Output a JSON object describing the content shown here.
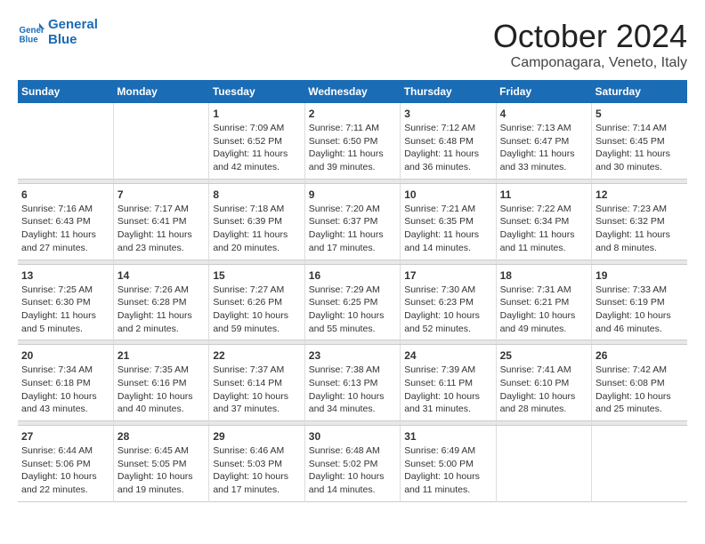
{
  "logo": {
    "line1": "General",
    "line2": "Blue"
  },
  "title": "October 2024",
  "location": "Camponagara, Veneto, Italy",
  "weekdays": [
    "Sunday",
    "Monday",
    "Tuesday",
    "Wednesday",
    "Thursday",
    "Friday",
    "Saturday"
  ],
  "rows": [
    [
      {
        "day": "",
        "detail": ""
      },
      {
        "day": "",
        "detail": ""
      },
      {
        "day": "1",
        "detail": "Sunrise: 7:09 AM\nSunset: 6:52 PM\nDaylight: 11 hours and 42 minutes."
      },
      {
        "day": "2",
        "detail": "Sunrise: 7:11 AM\nSunset: 6:50 PM\nDaylight: 11 hours and 39 minutes."
      },
      {
        "day": "3",
        "detail": "Sunrise: 7:12 AM\nSunset: 6:48 PM\nDaylight: 11 hours and 36 minutes."
      },
      {
        "day": "4",
        "detail": "Sunrise: 7:13 AM\nSunset: 6:47 PM\nDaylight: 11 hours and 33 minutes."
      },
      {
        "day": "5",
        "detail": "Sunrise: 7:14 AM\nSunset: 6:45 PM\nDaylight: 11 hours and 30 minutes."
      }
    ],
    [
      {
        "day": "6",
        "detail": "Sunrise: 7:16 AM\nSunset: 6:43 PM\nDaylight: 11 hours and 27 minutes."
      },
      {
        "day": "7",
        "detail": "Sunrise: 7:17 AM\nSunset: 6:41 PM\nDaylight: 11 hours and 23 minutes."
      },
      {
        "day": "8",
        "detail": "Sunrise: 7:18 AM\nSunset: 6:39 PM\nDaylight: 11 hours and 20 minutes."
      },
      {
        "day": "9",
        "detail": "Sunrise: 7:20 AM\nSunset: 6:37 PM\nDaylight: 11 hours and 17 minutes."
      },
      {
        "day": "10",
        "detail": "Sunrise: 7:21 AM\nSunset: 6:35 PM\nDaylight: 11 hours and 14 minutes."
      },
      {
        "day": "11",
        "detail": "Sunrise: 7:22 AM\nSunset: 6:34 PM\nDaylight: 11 hours and 11 minutes."
      },
      {
        "day": "12",
        "detail": "Sunrise: 7:23 AM\nSunset: 6:32 PM\nDaylight: 11 hours and 8 minutes."
      }
    ],
    [
      {
        "day": "13",
        "detail": "Sunrise: 7:25 AM\nSunset: 6:30 PM\nDaylight: 11 hours and 5 minutes."
      },
      {
        "day": "14",
        "detail": "Sunrise: 7:26 AM\nSunset: 6:28 PM\nDaylight: 11 hours and 2 minutes."
      },
      {
        "day": "15",
        "detail": "Sunrise: 7:27 AM\nSunset: 6:26 PM\nDaylight: 10 hours and 59 minutes."
      },
      {
        "day": "16",
        "detail": "Sunrise: 7:29 AM\nSunset: 6:25 PM\nDaylight: 10 hours and 55 minutes."
      },
      {
        "day": "17",
        "detail": "Sunrise: 7:30 AM\nSunset: 6:23 PM\nDaylight: 10 hours and 52 minutes."
      },
      {
        "day": "18",
        "detail": "Sunrise: 7:31 AM\nSunset: 6:21 PM\nDaylight: 10 hours and 49 minutes."
      },
      {
        "day": "19",
        "detail": "Sunrise: 7:33 AM\nSunset: 6:19 PM\nDaylight: 10 hours and 46 minutes."
      }
    ],
    [
      {
        "day": "20",
        "detail": "Sunrise: 7:34 AM\nSunset: 6:18 PM\nDaylight: 10 hours and 43 minutes."
      },
      {
        "day": "21",
        "detail": "Sunrise: 7:35 AM\nSunset: 6:16 PM\nDaylight: 10 hours and 40 minutes."
      },
      {
        "day": "22",
        "detail": "Sunrise: 7:37 AM\nSunset: 6:14 PM\nDaylight: 10 hours and 37 minutes."
      },
      {
        "day": "23",
        "detail": "Sunrise: 7:38 AM\nSunset: 6:13 PM\nDaylight: 10 hours and 34 minutes."
      },
      {
        "day": "24",
        "detail": "Sunrise: 7:39 AM\nSunset: 6:11 PM\nDaylight: 10 hours and 31 minutes."
      },
      {
        "day": "25",
        "detail": "Sunrise: 7:41 AM\nSunset: 6:10 PM\nDaylight: 10 hours and 28 minutes."
      },
      {
        "day": "26",
        "detail": "Sunrise: 7:42 AM\nSunset: 6:08 PM\nDaylight: 10 hours and 25 minutes."
      }
    ],
    [
      {
        "day": "27",
        "detail": "Sunrise: 6:44 AM\nSunset: 5:06 PM\nDaylight: 10 hours and 22 minutes."
      },
      {
        "day": "28",
        "detail": "Sunrise: 6:45 AM\nSunset: 5:05 PM\nDaylight: 10 hours and 19 minutes."
      },
      {
        "day": "29",
        "detail": "Sunrise: 6:46 AM\nSunset: 5:03 PM\nDaylight: 10 hours and 17 minutes."
      },
      {
        "day": "30",
        "detail": "Sunrise: 6:48 AM\nSunset: 5:02 PM\nDaylight: 10 hours and 14 minutes."
      },
      {
        "day": "31",
        "detail": "Sunrise: 6:49 AM\nSunset: 5:00 PM\nDaylight: 10 hours and 11 minutes."
      },
      {
        "day": "",
        "detail": ""
      },
      {
        "day": "",
        "detail": ""
      }
    ]
  ]
}
